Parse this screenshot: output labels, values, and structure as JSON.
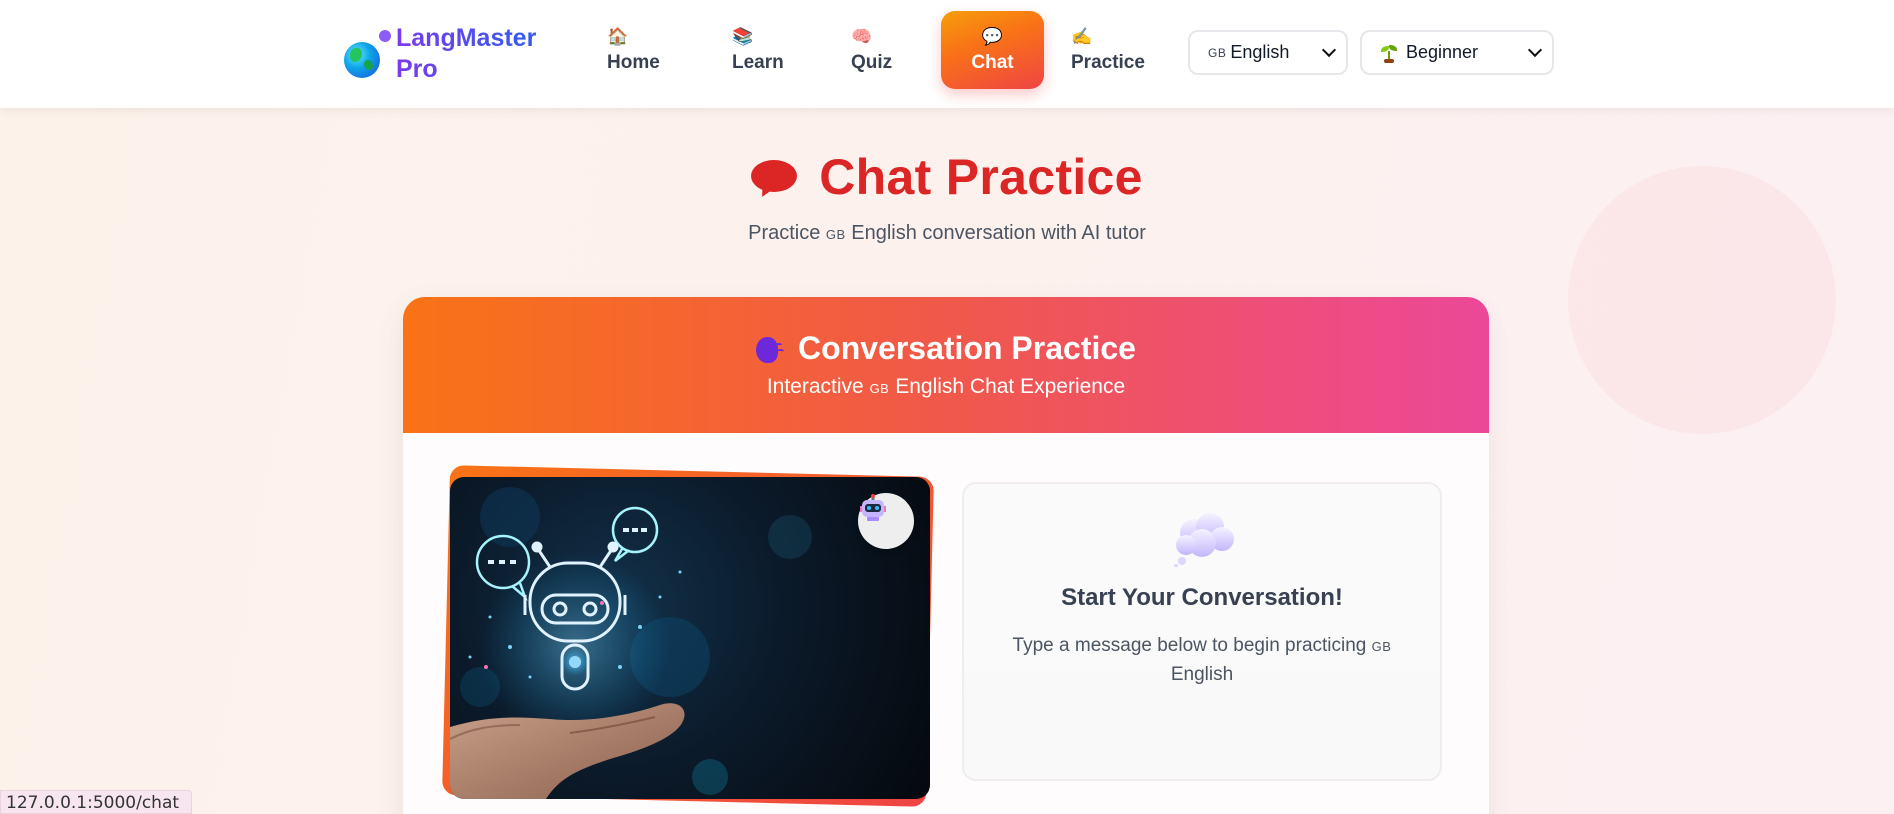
{
  "brand": {
    "name": "LangMaster Pro"
  },
  "nav": {
    "items": [
      {
        "label": "Home",
        "icon": "house-icon"
      },
      {
        "label": "Learn",
        "icon": "books-icon"
      },
      {
        "label": "Quiz",
        "icon": "brain-icon"
      },
      {
        "label": "Chat",
        "icon": "speech-balloon-icon",
        "active": true
      },
      {
        "label": "Practice",
        "icon": "writing-hand-icon"
      }
    ]
  },
  "selectors": {
    "language": {
      "flag": "GB",
      "value": "English"
    },
    "level": {
      "value": "Beginner",
      "icon": "seedling-icon"
    }
  },
  "page": {
    "title": "Chat Practice",
    "subtitle_before": "Practice",
    "subtitle_flag": "GB",
    "subtitle_after": "English conversation with AI tutor"
  },
  "card": {
    "title": "Conversation Practice",
    "subtitle_before": "Interactive",
    "subtitle_flag": "GB",
    "subtitle_after": "English Chat Experience"
  },
  "start": {
    "title": "Start Your Conversation!",
    "text_before": "Type a message below to begin practicing",
    "text_flag": "GB",
    "text_after": "English"
  },
  "status_bar": {
    "url": "127.0.0.1:5000/chat"
  },
  "colors": {
    "accent": "#dc2626",
    "brand_gradient_start": "#7c3aed",
    "brand_gradient_end": "#2563eb",
    "header_gradient_start": "#f97316",
    "header_gradient_end": "#ec4899"
  }
}
